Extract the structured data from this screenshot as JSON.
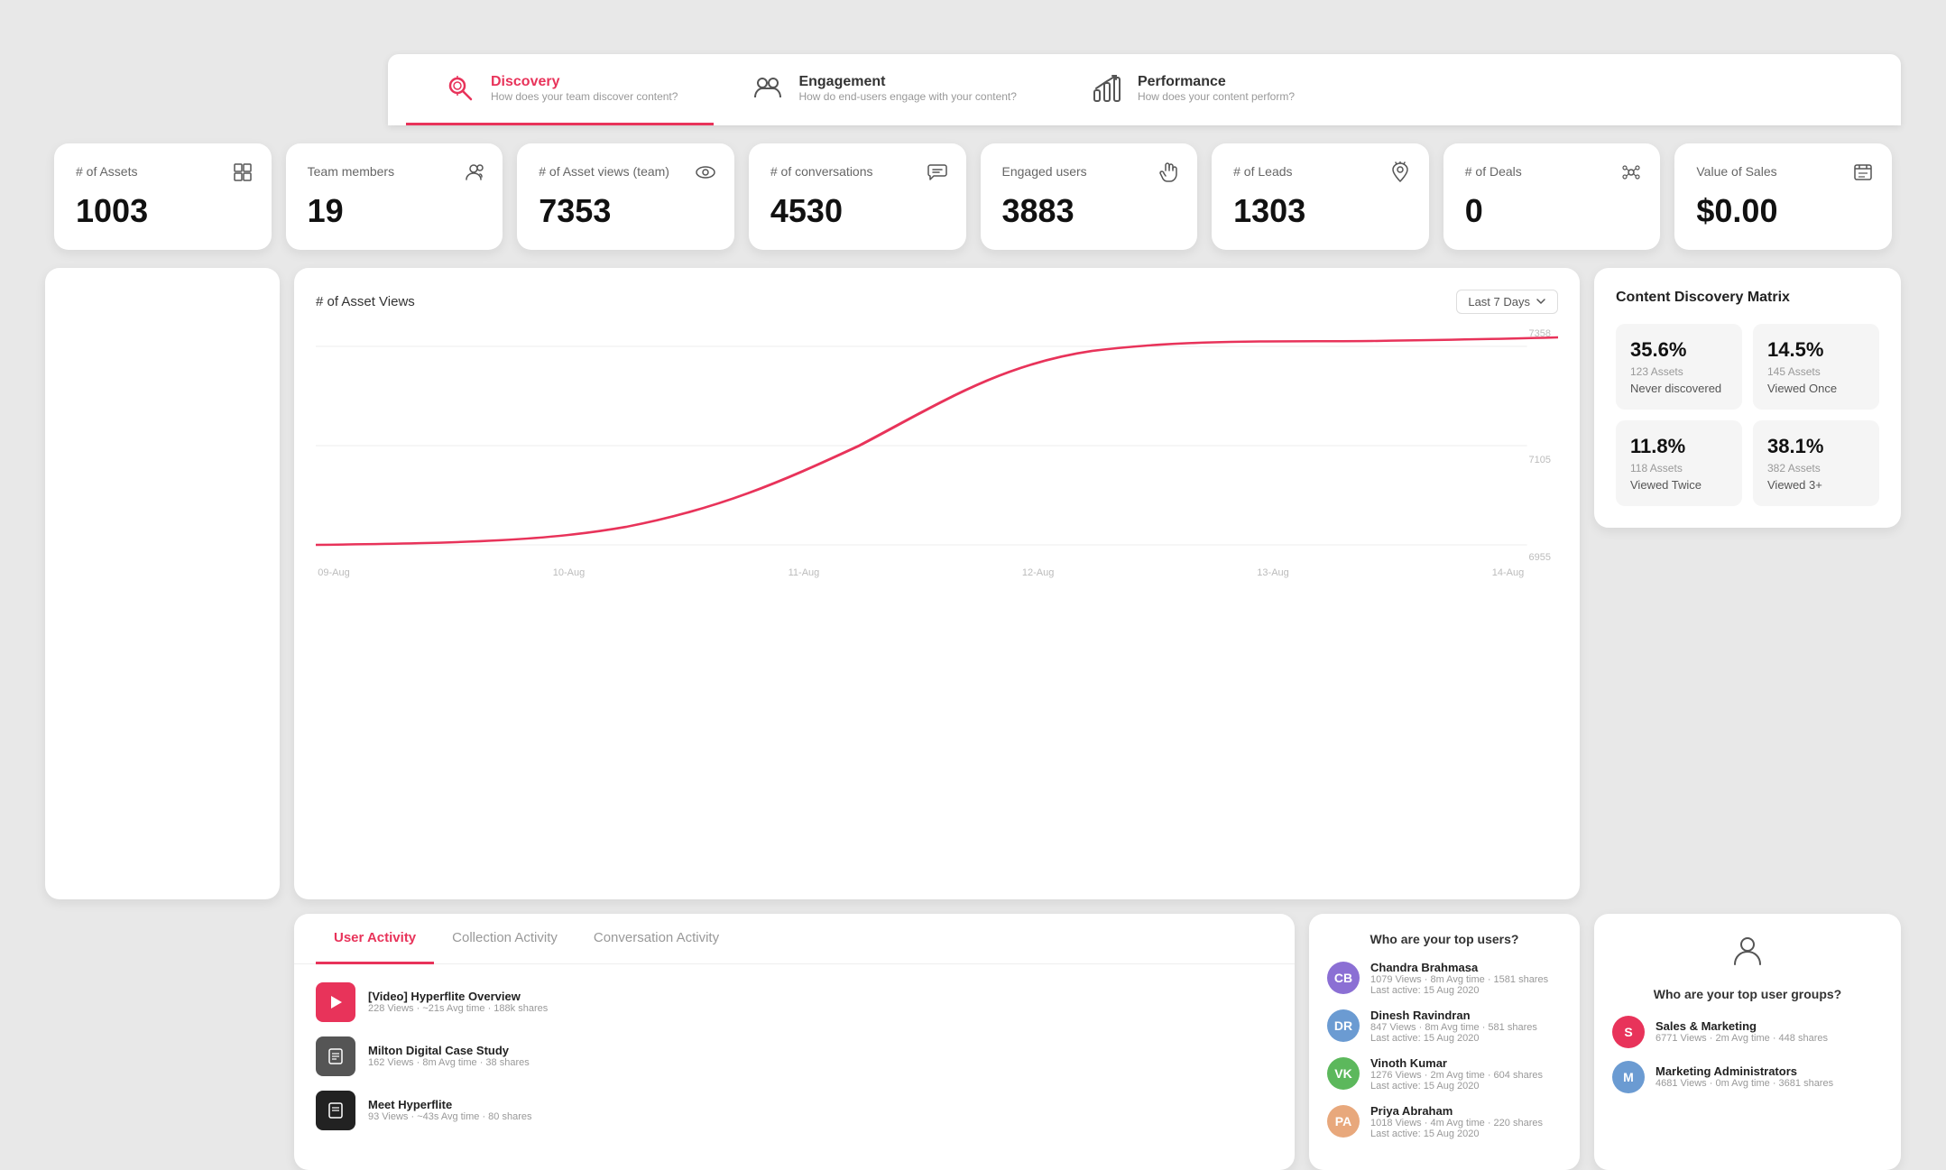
{
  "nav": {
    "tabs": [
      {
        "id": "discovery",
        "title": "Discovery",
        "subtitle": "How does your team discover content?",
        "active": true,
        "icon": "🔍"
      },
      {
        "id": "engagement",
        "title": "Engagement",
        "subtitle": "How do end-users engage with your content?",
        "active": false,
        "icon": "👥"
      },
      {
        "id": "performance",
        "title": "Performance",
        "subtitle": "How does your content perform?",
        "active": false,
        "icon": "📈"
      }
    ]
  },
  "stats": [
    {
      "label": "# of Assets",
      "value": "1003",
      "icon": "📄"
    },
    {
      "label": "Team members",
      "value": "19",
      "icon": "👤"
    },
    {
      "label": "# of Asset views (team)",
      "value": "7353",
      "icon": "👁"
    },
    {
      "label": "# of conversations",
      "value": "4530",
      "icon": "💬"
    },
    {
      "label": "Engaged users",
      "value": "3883",
      "icon": "☝"
    },
    {
      "label": "# of Leads",
      "value": "1303",
      "icon": "🌿"
    },
    {
      "label": "# of Deals",
      "value": "0",
      "icon": "✨"
    },
    {
      "label": "Value of Sales",
      "value": "$0.00",
      "icon": "📋"
    }
  ],
  "chart": {
    "title": "# of Asset Views",
    "filter_label": "Last 7 Days",
    "y_max": "7358",
    "y_mid": "7105",
    "y_low": "6955",
    "x_labels": [
      "09-Aug",
      "10-Aug",
      "11-Aug",
      "12-Aug",
      "13-Aug",
      "14-Aug"
    ]
  },
  "discovery_matrix": {
    "title": "Content Discovery Matrix",
    "cells": [
      {
        "pct": "35.6%",
        "count": "123 Assets",
        "label": "Never discovered"
      },
      {
        "pct": "14.5%",
        "count": "145 Assets",
        "label": "Viewed Once"
      },
      {
        "pct": "11.8%",
        "count": "118 Assets",
        "label": "Viewed Twice"
      },
      {
        "pct": "38.1%",
        "count": "382 Assets",
        "label": "Viewed 3+"
      }
    ]
  },
  "top_users": {
    "title": "Who are your top users?",
    "users": [
      {
        "name": "Chandra Brahmasa",
        "stats": "1079 Views · 8m Avg time · 1581 shares",
        "last_active": "Last active: 15 Aug 2020",
        "avatar_color": "#8B6FD4",
        "initials": "CB"
      },
      {
        "name": "Dinesh Ravindran",
        "stats": "847 Views · 8m Avg time · 581 shares",
        "last_active": "Last active: 15 Aug 2020",
        "avatar_color": "#6B9BD2",
        "initials": "DR"
      },
      {
        "name": "Vinoth Kumar",
        "stats": "1276 Views · 2m Avg time · 604 shares",
        "last_active": "Last active: 15 Aug 2020",
        "avatar_color": "#5CB85C",
        "initials": "VK"
      },
      {
        "name": "Priya Abraham",
        "stats": "1018 Views · 4m Avg time · 220 shares",
        "last_active": "Last active: 15 Aug 2020",
        "avatar_color": "#E8A87C",
        "initials": "PA"
      }
    ]
  },
  "top_groups": {
    "title": "Who are your top user groups?",
    "groups": [
      {
        "name": "Sales & Marketing",
        "stats": "6771 Views · 2m Avg time · 448 shares",
        "avatar_color": "#e8335a",
        "initials": "S"
      },
      {
        "name": "Marketing Administrators",
        "stats": "4681 Views · 0m Avg time · 3681 shares",
        "avatar_color": "#6B9BD2",
        "initials": "M"
      }
    ]
  },
  "activity": {
    "tabs": [
      "User Activity",
      "Collection Activity",
      "Conversation Activity"
    ],
    "active_tab": "User Activity",
    "assets": [
      {
        "name": "[Video] Hyperflite Overview",
        "stats": "228 Views · ~21s Avg time · 188k shares",
        "color": "#e8335a"
      },
      {
        "name": "Milton Digital Case Study",
        "stats": "162 Views · 8m Avg time · 38 shares",
        "color": "#333"
      },
      {
        "name": "Meet Hyperflite",
        "stats": "93 Views · ~43s Avg time · 80 shares",
        "color": "#222"
      }
    ]
  }
}
